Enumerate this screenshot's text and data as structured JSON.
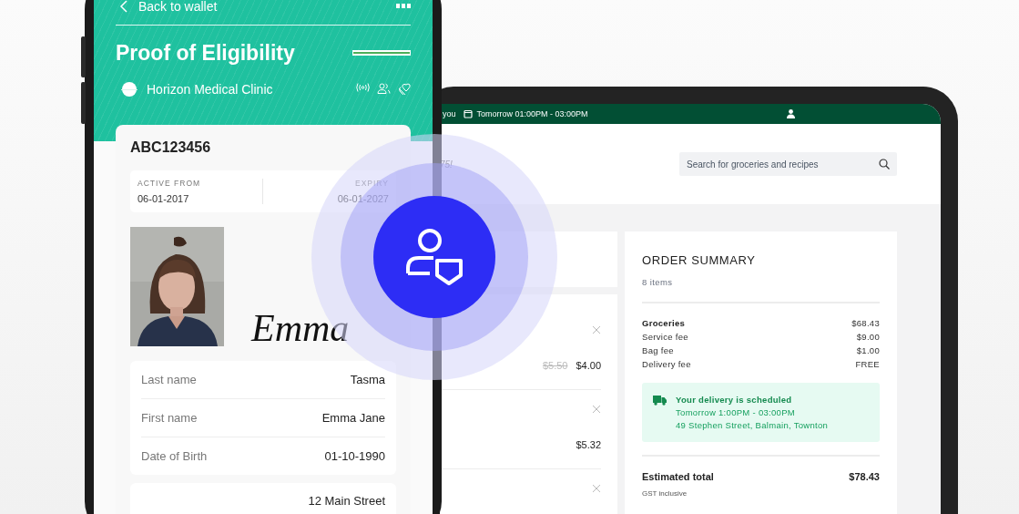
{
  "phone": {
    "back_label": "Back to wallet",
    "title": "Proof of Eligibility",
    "issuer": "Horizon Medical Clinic",
    "card": {
      "id": "ABC123456",
      "dates": [
        {
          "label": "ACTIVE FROM",
          "value": "06-01-2017"
        },
        {
          "label": "EXPIRY",
          "value": "06-01-2027"
        }
      ],
      "signature": "Emma",
      "details": [
        {
          "label": "Last name",
          "value": "Tasma"
        },
        {
          "label": "First name",
          "value": "Emma Jane"
        },
        {
          "label": "Date of Birth",
          "value": "01-10-1990"
        }
      ],
      "address": "12 Main Street"
    }
  },
  "tablet": {
    "top_bar": {
      "delivery_prefix": "you",
      "delivery_time": "Tomorrow 01:00PM - 03:00PM"
    },
    "promo_text": "75!",
    "search": {
      "placeholder": "Search for groceries and recipes"
    },
    "cart_items": [
      {
        "old_price": "$5.50",
        "price": "$4.00",
        "removable": true
      },
      {
        "price": "$5.32",
        "removable": true
      },
      {
        "removable": true
      }
    ],
    "order_summary": {
      "title": "ORDER SUMMARY",
      "item_count": "8 items",
      "lines": [
        {
          "label": "Groceries",
          "value": "$68.43",
          "emphasis": true
        },
        {
          "label": "Service fee",
          "value": "$9.00",
          "emphasis": false
        },
        {
          "label": "Bag fee",
          "value": "$1.00",
          "emphasis": false
        },
        {
          "label": "Delivery fee",
          "value": "FREE",
          "emphasis": false
        }
      ],
      "delivery": {
        "title": "Your delivery is scheduled",
        "time": "Tomorrow 1:00PM - 03:00PM",
        "address": "49 Stephen Street, Balmain, Townton"
      },
      "total": {
        "label": "Estimated total",
        "value": "$78.43",
        "note": "GST inclusive"
      }
    }
  }
}
